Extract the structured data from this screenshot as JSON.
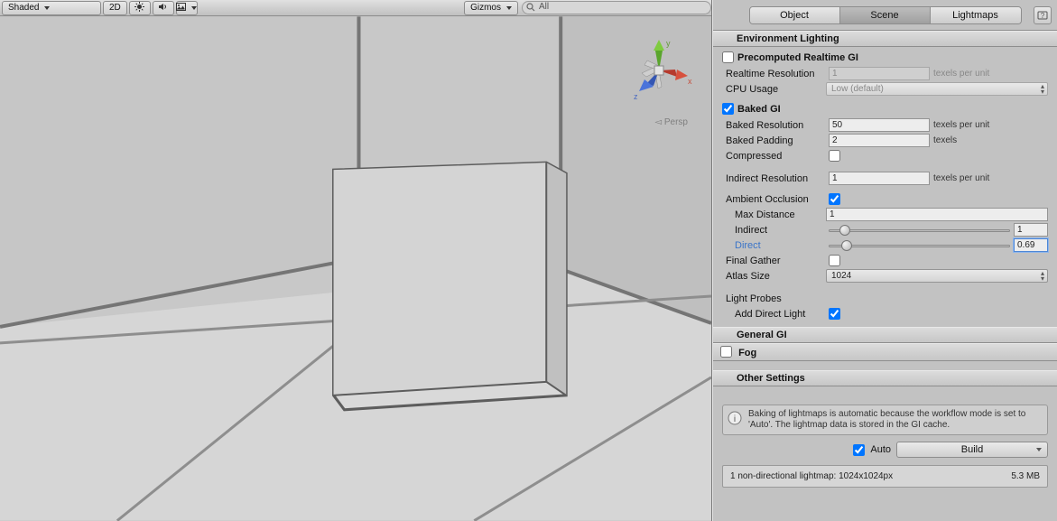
{
  "scene_toolbar": {
    "shading_mode": "Shaded",
    "view2d_label": "2D",
    "gizmos_label": "Gizmos",
    "search_placeholder": "All"
  },
  "viewport": {
    "persp_label": "Persp",
    "axis_x": "x",
    "axis_y": "y",
    "axis_z": "z"
  },
  "inspector_tabs": {
    "object": "Object",
    "scene": "Scene",
    "lightmaps": "Lightmaps"
  },
  "env": {
    "header": "Environment Lighting",
    "precomputed_header": "Precomputed Realtime GI",
    "precomputed_checked": false,
    "realtime_res_label": "Realtime Resolution",
    "realtime_res_value": "1",
    "realtime_res_unit": "texels per unit",
    "cpu_usage_label": "CPU Usage",
    "cpu_usage_value": "Low (default)",
    "baked_header": "Baked GI",
    "baked_checked": true,
    "baked_res_label": "Baked Resolution",
    "baked_res_value": "50",
    "baked_res_unit": "texels per unit",
    "baked_pad_label": "Baked Padding",
    "baked_pad_value": "2",
    "baked_pad_unit": "texels",
    "compressed_label": "Compressed",
    "compressed_checked": false,
    "indirect_res_label": "Indirect Resolution",
    "indirect_res_value": "1",
    "indirect_res_unit": "texels per unit",
    "ao_label": "Ambient Occlusion",
    "ao_checked": true,
    "ao_max_dist_label": "Max Distance",
    "ao_max_dist_value": "1",
    "ao_indirect_label": "Indirect",
    "ao_indirect_slider": 0.09,
    "ao_indirect_value": "1",
    "ao_direct_label": "Direct",
    "ao_direct_slider": 0.1,
    "ao_direct_value": "0.69",
    "final_gather_label": "Final Gather",
    "final_gather_checked": false,
    "atlas_size_label": "Atlas Size",
    "atlas_size_value": "1024",
    "light_probes_label": "Light Probes",
    "add_direct_light_label": "Add Direct Light",
    "add_direct_light_checked": true
  },
  "general_gi_header": "General GI",
  "fog_header": "Fog",
  "fog_checked": false,
  "other_header": "Other Settings",
  "info_text": "Baking of lightmaps is automatic because the workflow mode is set to 'Auto'. The lightmap data is stored in the GI cache.",
  "auto_label": "Auto",
  "auto_checked": true,
  "build_label": "Build",
  "status_left": "1 non-directional lightmap: 1024x1024px",
  "status_right": "5.3 MB"
}
